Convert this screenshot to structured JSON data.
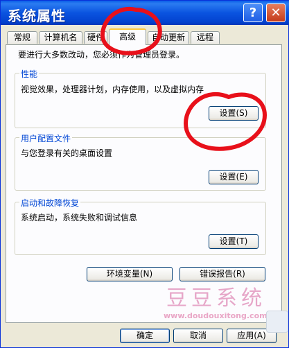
{
  "window": {
    "title": "系统属性"
  },
  "titlebar_buttons": {
    "help": "?",
    "close": "✕"
  },
  "tabs": [
    {
      "label": "常规"
    },
    {
      "label": "计算机名"
    },
    {
      "label": "硬件"
    },
    {
      "label": "高级",
      "active": true
    },
    {
      "label": "自动更新"
    },
    {
      "label": "远程"
    }
  ],
  "note": "要进行大多数改动，您必须作为管理员登录。",
  "groups": {
    "performance": {
      "label": "性能",
      "desc": "视觉效果，处理器计划，内存使用，以及虚拟内存",
      "button": "设置(S)"
    },
    "profiles": {
      "label": "用户配置文件",
      "desc": "与您登录有关的桌面设置",
      "button": "设置(E)"
    },
    "startup": {
      "label": "启动和故障恢复",
      "desc": "系统启动，系统失败和调试信息",
      "button": "设置(T)"
    }
  },
  "buttons": {
    "env": "环境变量(N)",
    "error": "错误报告(R)",
    "ok": "确定",
    "cancel": "取消",
    "apply": "应用(A)"
  },
  "watermark": {
    "name": "豆豆系统",
    "url": "www.doudouxitong.com"
  },
  "annotation_color": "#e8101a"
}
